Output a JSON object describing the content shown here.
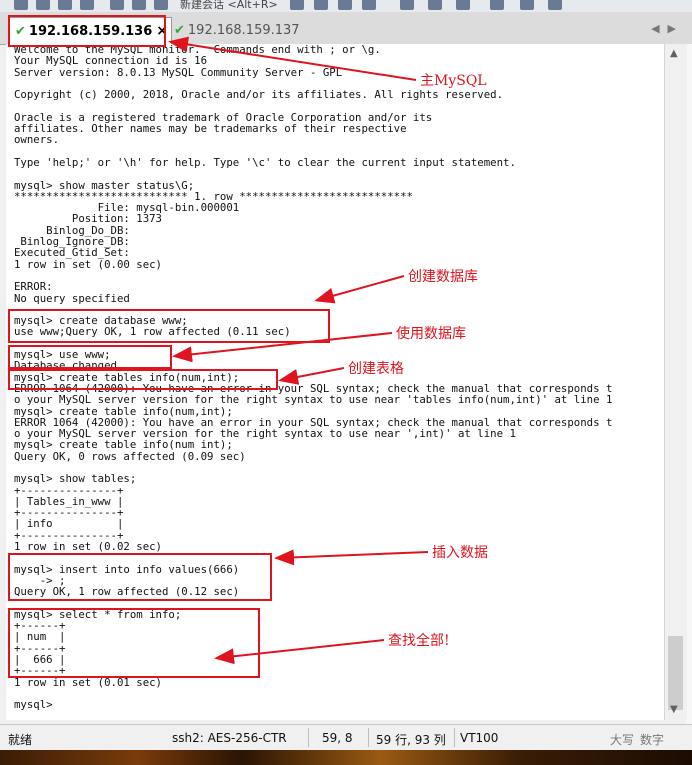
{
  "toolbar": {
    "partial_text": "新建会话 <Alt+R>"
  },
  "tabs": [
    {
      "label": "192.168.159.136",
      "status": "connected",
      "active": true,
      "close": "×"
    },
    {
      "label": "192.168.159.137",
      "status": "connected",
      "active": false
    }
  ],
  "tab_nav": {
    "prev": "◀",
    "next": "▶"
  },
  "terminal": {
    "lines": [
      "Welcome to the MySQL monitor.  Commands end with ; or \\g.",
      "Your MySQL connection id is 16",
      "Server version: 8.0.13 MySQL Community Server - GPL",
      "",
      "Copyright (c) 2000, 2018, Oracle and/or its affiliates. All rights reserved.",
      "",
      "Oracle is a registered trademark of Oracle Corporation and/or its",
      "affiliates. Other names may be trademarks of their respective",
      "owners.",
      "",
      "Type 'help;' or '\\h' for help. Type '\\c' to clear the current input statement.",
      "",
      "mysql> show master status\\G;",
      "*************************** 1. row ***************************",
      "             File: mysql-bin.000001",
      "         Position: 1373",
      "     Binlog_Do_DB:",
      " Binlog_Ignore_DB:",
      "Executed_Gtid_Set:",
      "1 row in set (0.00 sec)",
      "",
      "ERROR:",
      "No query specified",
      "",
      "mysql> create database www;",
      "use www;Query OK, 1 row affected (0.11 sec)",
      "",
      "mysql> use www;",
      "Database changed",
      "mysql> create tables info(num,int);",
      "ERROR 1064 (42000): You have an error in your SQL syntax; check the manual that corresponds t",
      "o your MySQL server version for the right syntax to use near 'tables info(num,int)' at line 1",
      "mysql> create table info(num,int);",
      "ERROR 1064 (42000): You have an error in your SQL syntax; check the manual that corresponds t",
      "o your MySQL server version for the right syntax to use near ',int)' at line 1",
      "mysql> create table info(num int);",
      "Query OK, 0 rows affected (0.09 sec)",
      "",
      "mysql> show tables;",
      "+---------------+",
      "| Tables_in_www |",
      "+---------------+",
      "| info          |",
      "+---------------+",
      "1 row in set (0.02 sec)",
      "",
      "mysql> insert into info values(666)",
      "    -> ;",
      "Query OK, 1 row affected (0.12 sec)",
      "",
      "mysql> select * from info;",
      "+------+",
      "| num  |",
      "+------+",
      "|  666 |",
      "+------+",
      "1 row in set (0.01 sec)",
      "",
      "mysql>"
    ]
  },
  "annotations": {
    "main_mysql": "主MySQL",
    "create_db": "创建数据库",
    "use_db": "使用数据库",
    "create_table": "创建表格",
    "insert_data": "插入数据",
    "select_all": "查找全部!",
    "color": "#e0141e"
  },
  "statusbar": {
    "ready": "就绪",
    "encryption": "ssh2: AES-256-CTR",
    "cursor": "59,  8",
    "size": "59 行, 93 列",
    "terminal_type": "VT100",
    "caps": "大写",
    "num": "数字"
  }
}
